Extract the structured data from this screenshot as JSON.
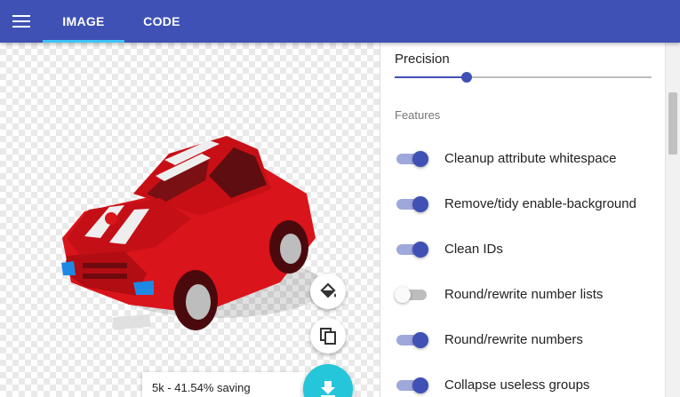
{
  "toolbar": {
    "tabs": [
      {
        "label": "IMAGE",
        "active": true
      },
      {
        "label": "CODE",
        "active": false
      }
    ],
    "accent_color": "#3f51b5",
    "underline_color": "#40c4ff"
  },
  "preview": {
    "savings_text": "5k - 41.54% saving",
    "actions": [
      "paint-bucket-icon",
      "copy-icon",
      "download-icon"
    ]
  },
  "settings": {
    "precision_label": "Precision",
    "precision_value_fraction": 0.28,
    "features_label": "Features",
    "features": [
      {
        "label": "Cleanup attribute whitespace",
        "enabled": true
      },
      {
        "label": "Remove/tidy enable-background",
        "enabled": true
      },
      {
        "label": "Clean IDs",
        "enabled": true
      },
      {
        "label": "Round/rewrite number lists",
        "enabled": false
      },
      {
        "label": "Round/rewrite numbers",
        "enabled": true
      },
      {
        "label": "Collapse useless groups",
        "enabled": true
      }
    ]
  }
}
